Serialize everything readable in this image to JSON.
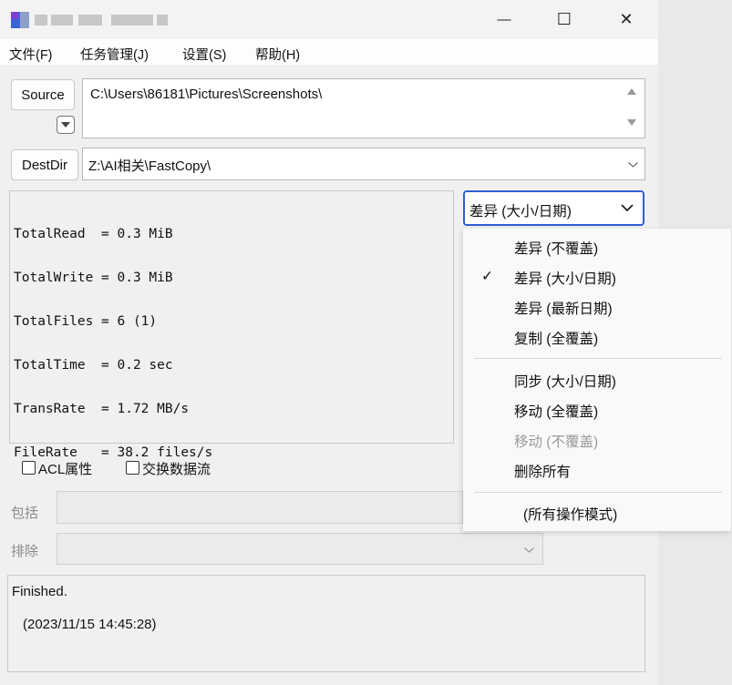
{
  "titlebar": {
    "minimize_glyph": "—",
    "maximize_glyph": "☐",
    "close_glyph": "✕"
  },
  "menu": [
    "文件(F)",
    "任务管理(J)",
    "设置(S)",
    "帮助(H)"
  ],
  "source": {
    "button_label": "Source",
    "path": "C:\\Users\\86181\\Pictures\\Screenshots\\"
  },
  "dest": {
    "button_label": "DestDir",
    "path": "Z:\\AI相关\\FastCopy\\"
  },
  "stats": [
    "TotalRead  = 0.3 MiB",
    "TotalWrite = 0.3 MiB",
    "TotalFiles = 6 (1)",
    "TotalTime  = 0.2 sec",
    "TransRate  = 1.72 MB/s",
    "FileRate   = 38.2 files/s"
  ],
  "mode_select": {
    "value": "差异 (大小/日期)",
    "chevron": "⌄"
  },
  "mode_options": [
    {
      "label": "差异 (不覆盖)",
      "checked": false,
      "disabled": false
    },
    {
      "label": "差异 (大小/日期)",
      "checked": true,
      "disabled": false
    },
    {
      "label": "差异 (最新日期)",
      "checked": false,
      "disabled": false
    },
    {
      "label": "复制 (全覆盖)",
      "checked": false,
      "disabled": false
    },
    {
      "label": "同步 (大小/日期)",
      "checked": false,
      "disabled": false
    },
    {
      "label": "移动 (全覆盖)",
      "checked": false,
      "disabled": false
    },
    {
      "label": "移动 (不覆盖)",
      "checked": false,
      "disabled": true
    },
    {
      "label": "删除所有",
      "checked": false,
      "disabled": false
    },
    {
      "label": "(所有操作模式)",
      "checked": false,
      "disabled": false
    }
  ],
  "check_mark": "✓",
  "options": {
    "acl_label": "ACL属性",
    "stream_label": "交换数据流"
  },
  "filters": {
    "include_label": "包括",
    "exclude_label": "排除"
  },
  "status": {
    "line1": "Finished.",
    "line2": "(2023/11/15 14:45:28)"
  },
  "colors": {
    "accent_border": "#2f5fd0",
    "disabled_text": "#9a9a9a"
  }
}
